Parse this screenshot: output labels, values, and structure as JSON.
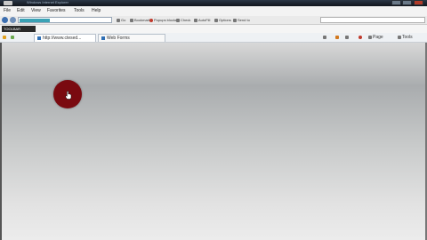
{
  "window": {
    "title": "Windows Internet Explorer",
    "controls": [
      "minimize",
      "maximize",
      "close"
    ]
  },
  "menu": {
    "items": [
      "File",
      "Edit",
      "View",
      "Favorites",
      "Tools",
      "Help"
    ]
  },
  "nav": {
    "address_value": "",
    "links": [
      "Go",
      "Bookmarks",
      "Popups blocked",
      "Check",
      "AutoFill",
      "Options",
      "Send to"
    ],
    "search_placeholder": ""
  },
  "favorites": {
    "logo_text": "TOOLBAR"
  },
  "tabs": [
    {
      "label": "http://www.ctesed...",
      "active": true
    },
    {
      "label": "Web Forms",
      "active": false
    }
  ],
  "toolbar_right": {
    "page_label": "Page",
    "tools_label": "Tools"
  },
  "content": {
    "click_marker_color": "#7a0a10",
    "cursor": "hand-cursor"
  }
}
